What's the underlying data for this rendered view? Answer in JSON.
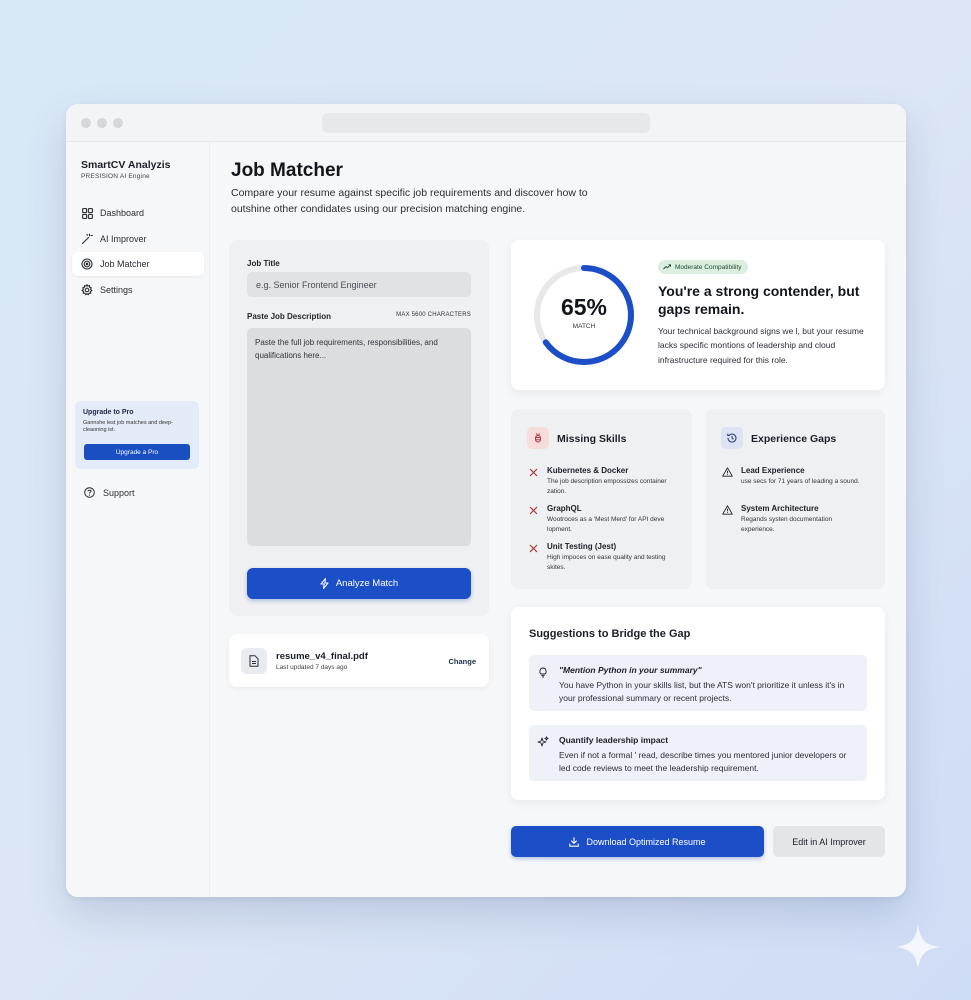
{
  "sidebar": {
    "brand": "SmartCV Analyzis",
    "brand_sub": "PRESISION AI Engine",
    "items": [
      {
        "label": "Dashboard",
        "icon": "grid-icon"
      },
      {
        "label": "AI Improver",
        "icon": "magic-wand-icon"
      },
      {
        "label": "Job Matcher",
        "icon": "target-icon",
        "active": true
      },
      {
        "label": "Settings",
        "icon": "gear-icon"
      }
    ],
    "upgrade": {
      "title": "Upgrade to Pro",
      "text": "Gannshe lest job matches and deep-cleaoning ist.",
      "button": "Upgrade a Pro"
    },
    "support": "Support"
  },
  "main": {
    "title": "Job Matcher",
    "description": "Compare your resume against specific job requirements and discover how to outshine other condidates using our precision matching engine."
  },
  "form": {
    "job_title_label": "Job Title",
    "job_title_placeholder": "e.g. Senior Frontend Engineer",
    "description_label": "Paste Job Description",
    "max_chars": "MAX 5600 CHARACTERS",
    "description_placeholder": "Paste the full job requirements, responsibilities, and qualifications here...",
    "analyze_button": "Analyze Match"
  },
  "file": {
    "name": "resume_v4_final.pdf",
    "updated": "Last updated 7 days ago",
    "change": "Change"
  },
  "score": {
    "value": "65%",
    "percent": 65,
    "label": "MATCH",
    "badge": "Moderate Compatibility",
    "headline": "You're a strong contender, but gaps remain.",
    "text": "Your technical background signs we l, but your resume lacks specific montions of leadership and cloud infrastructure required for this role."
  },
  "missing_skills": {
    "title": "Missing Skills",
    "items": [
      {
        "name": "Kubernetes & Docker",
        "desc": "The job description empossizes container zation."
      },
      {
        "name": "GraphQL",
        "desc": "Wootroces as a 'Mest Merd' for API deve lopment."
      },
      {
        "name": "Unit Testing (Jest)",
        "desc": "High impoces on ease quality and testing skites."
      }
    ]
  },
  "experience_gaps": {
    "title": "Experience Gaps",
    "items": [
      {
        "name": "Lead Experience",
        "desc": "use secs for 71 years of leading a sound."
      },
      {
        "name": "System Architecture",
        "desc": "Regands systen documentation experience."
      }
    ]
  },
  "suggestions": {
    "title": "Suggestions to Bridge the Gap",
    "items": [
      {
        "head": "\"Mention Python in your summary\"",
        "text": "You have Python in your skills list, but the ATS won't prioritize it unless it's in your professional summary or recent projects.",
        "icon": "lightbulb-icon"
      },
      {
        "head": "Quantify leadership impact",
        "text": "Even if not a formal ' read, describe times you mentored junior developers or led code reviews to meet the leadership requirement.",
        "icon": "sparkle-icon"
      }
    ]
  },
  "actions": {
    "download": "Download Optimized Resume",
    "edit": "Edit in AI Improver"
  },
  "colors": {
    "accent": "#1c4fc7",
    "danger": "#b2353b",
    "success_bg": "#dbeedf"
  }
}
